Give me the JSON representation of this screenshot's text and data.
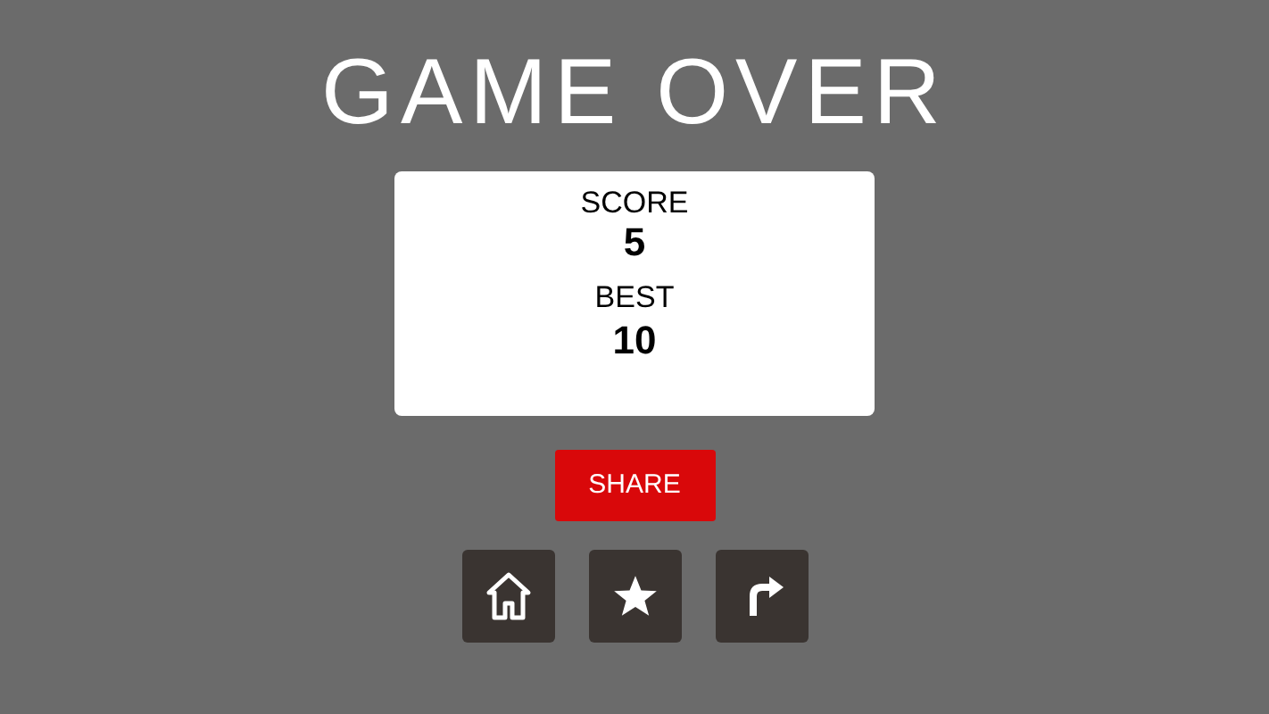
{
  "title": "GAME OVER",
  "score_card": {
    "score_label": "SCORE",
    "score": "5",
    "best_label": "BEST",
    "best": "10"
  },
  "share_button": "SHARE",
  "icon_buttons": [
    {
      "kind": "home"
    },
    {
      "kind": "star"
    },
    {
      "kind": "redo"
    }
  ]
}
